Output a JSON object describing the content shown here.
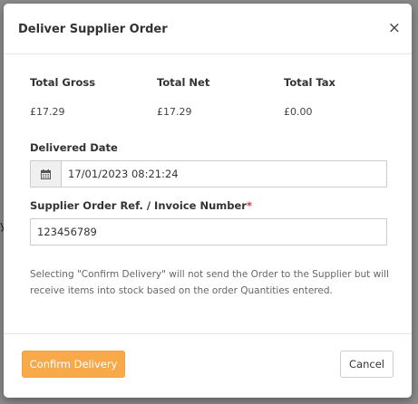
{
  "dialog": {
    "title": "Deliver Supplier Order",
    "close_symbol": "×"
  },
  "totals": {
    "gross_label": "Total Gross",
    "gross_value": "£17.29",
    "net_label": "Total Net",
    "net_value": "£17.29",
    "tax_label": "Total Tax",
    "tax_value": "£0.00"
  },
  "delivered_date": {
    "label": "Delivered Date",
    "value": "17/01/2023 08:21:24",
    "icon": "calendar-icon"
  },
  "supplier_ref": {
    "label": "Supplier Order Ref. / Invoice Number",
    "required_marker": "*",
    "value": "123456789"
  },
  "help_text": "Selecting \"Confirm Delivery\" will not send the Order to the Supplier but will receive items into stock based on the order Quantities entered.",
  "footer": {
    "confirm_label": "Confirm Delivery",
    "cancel_label": "Cancel"
  },
  "background": {
    "fragment": "y"
  },
  "colors": {
    "primary_button": "#f8a94a",
    "required": "#e0303b",
    "overlay": "#8a8a8a"
  }
}
